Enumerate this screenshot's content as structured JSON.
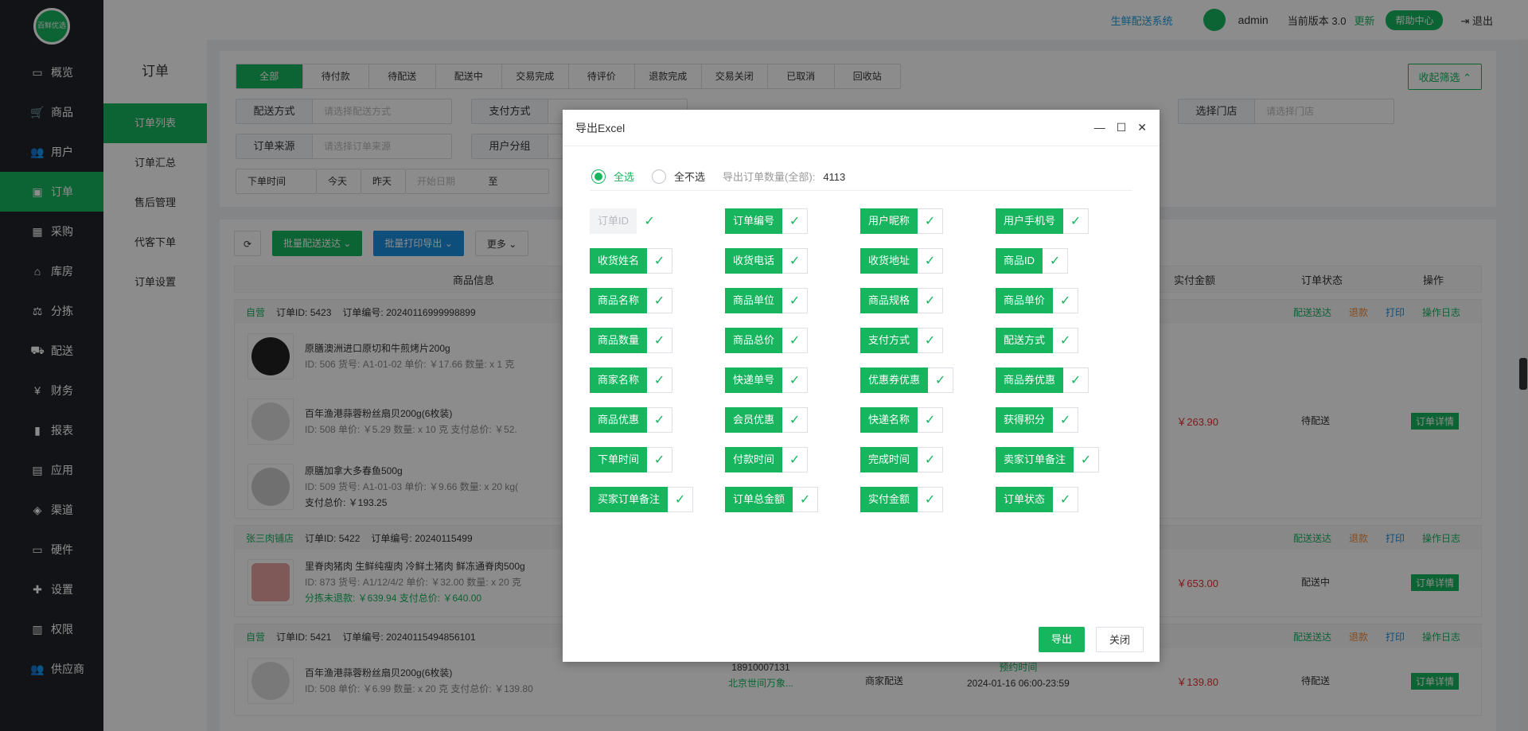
{
  "brand": {
    "logo_text": "百鲜优选"
  },
  "sidebar": {
    "items": [
      {
        "icon": "monitor-icon",
        "glyph": "▭",
        "label": "概览"
      },
      {
        "icon": "cart-icon",
        "glyph": "🛒",
        "label": "商品"
      },
      {
        "icon": "users-icon",
        "glyph": "👥",
        "label": "用户"
      },
      {
        "icon": "money-icon",
        "glyph": "▣",
        "label": "订单"
      },
      {
        "icon": "bus-icon",
        "glyph": "▦",
        "label": "采购"
      },
      {
        "icon": "home-icon",
        "glyph": "⌂",
        "label": "库房"
      },
      {
        "icon": "scale-icon",
        "glyph": "⚖",
        "label": "分拣"
      },
      {
        "icon": "truck-icon",
        "glyph": "⛟",
        "label": "配送"
      },
      {
        "icon": "yen-icon",
        "glyph": "¥",
        "label": "财务"
      },
      {
        "icon": "chart-icon",
        "glyph": "▮",
        "label": "报表"
      },
      {
        "icon": "grid-icon",
        "glyph": "▤",
        "label": "应用"
      },
      {
        "icon": "cube-icon",
        "glyph": "◈",
        "label": "渠道"
      },
      {
        "icon": "hardware-icon",
        "glyph": "▭",
        "label": "硬件"
      },
      {
        "icon": "puzzle-icon",
        "glyph": "✚",
        "label": "设置"
      },
      {
        "icon": "bank-icon",
        "glyph": "▥",
        "label": "权限"
      },
      {
        "icon": "supplier-icon",
        "glyph": "👥",
        "label": "供应商"
      }
    ]
  },
  "subnav": {
    "title": "订单",
    "items": [
      "订单列表",
      "订单汇总",
      "售后管理",
      "代客下单",
      "订单设置"
    ]
  },
  "topbar": {
    "system": "生鲜配送系统",
    "user": "admin",
    "version_label": "当前版本",
    "version": "3.0",
    "update": "更新",
    "help": "帮助中心",
    "logout": "退出"
  },
  "filter": {
    "tabs": [
      "全部",
      "待付款",
      "待配送",
      "配送中",
      "交易完成",
      "待评价",
      "退款完成",
      "交易关闭",
      "已取消",
      "回收站"
    ],
    "collapse": "收起筛选",
    "row1": [
      {
        "label": "配送方式",
        "placeholder": "请选择配送方式"
      },
      {
        "label": "支付方式",
        "placeholder": ""
      }
    ],
    "store": {
      "label": "选择门店",
      "placeholder": "请选择门店"
    },
    "row2": [
      {
        "label": "订单来源",
        "placeholder": "请选择订单来源"
      },
      {
        "label": "用户分组",
        "placeholder": ""
      }
    ],
    "date": {
      "type": "下单时间",
      "today": "今天",
      "yesterday": "昨天",
      "start": "开始日期",
      "to": "至"
    }
  },
  "list": {
    "buttons": {
      "batch_delivery": "批量配送送达",
      "batch_print": "批量打印导出",
      "more": "更多"
    },
    "columns": {
      "product": "商品信息",
      "amount": "实付金额",
      "status": "订单状态",
      "ops": "操作"
    },
    "group_actions": {
      "deliver": "配送送达",
      "refund": "退款",
      "print": "打印",
      "log": "操作日志",
      "detail": "订单详情"
    },
    "orders": [
      {
        "shop": "自营",
        "id_label": "订单ID:",
        "id": "5423",
        "no_label": "订单编号:",
        "no": "20240116999998899",
        "amount": "￥263.90",
        "status": "待配送",
        "products": [
          {
            "name": "原膳澳洲进口原切和牛煎烤片200g",
            "meta": "ID: 506   货号: A1-01-02   单价: ￥17.66   数量: x 1 克"
          },
          {
            "name": "百年渔港蒜蓉粉丝扇贝200g(6枚装)",
            "meta": "ID: 508   单价: ￥5.29   数量: x 10 克   支付总价: ￥52."
          },
          {
            "name": "原膳加拿大多春鱼500g",
            "meta": "ID: 509   货号: A1-01-03   单价: ￥9.66   数量: x 20 kg(",
            "extra": "支付总价: ￥193.25"
          }
        ]
      },
      {
        "shop": "张三肉铺店",
        "id_label": "订单ID:",
        "id": "5422",
        "no_label": "订单编号:",
        "no": "20240115499",
        "amount": "￥653.00",
        "status": "配送中",
        "products": [
          {
            "name": "里脊肉猪肉 生鲜纯瘦肉 冷鲜土猪肉 鲜冻通脊肉500g",
            "meta": "ID: 873   货号: A1/12/4/2   单价: ￥32.00   数量: x 20 克",
            "extra": "分拣未退款: ￥639.94   支付总价: ￥640.00"
          }
        ]
      },
      {
        "shop": "自营",
        "id_label": "订单ID:",
        "id": "5421",
        "no_label": "订单编号:",
        "no": "20240115494856101",
        "amount": "￥139.80",
        "status": "待配送",
        "products": [
          {
            "name": "百年渔港蒜蓉粉丝扇贝200g(6枚装)",
            "meta": "ID: 508   单价: ￥6.99   数量: x 20 克   支付总价: ￥139.80"
          }
        ],
        "contact": "18910007131",
        "address": "北京世间万象...",
        "delivery": "商家配送",
        "reserve": "预约时间",
        "slot": "2024-01-16 06:00-23:59"
      }
    ]
  },
  "modal": {
    "title": "导出Excel",
    "select_all": "全选",
    "select_none": "全不选",
    "count_label": "导出订单数量(全部):",
    "count": "4113",
    "fields": [
      "订单ID",
      "订单编号",
      "用户昵称",
      "用户手机号",
      "收货姓名",
      "收货电话",
      "收货地址",
      "商品ID",
      "商品名称",
      "商品单位",
      "商品规格",
      "商品单价",
      "商品数量",
      "商品总价",
      "支付方式",
      "配送方式",
      "商家名称",
      "快递单号",
      "优惠券优惠",
      "商品券优惠",
      "商品优惠",
      "会员优惠",
      "快递名称",
      "获得积分",
      "下单时间",
      "付款时间",
      "完成时间",
      "卖家订单备注",
      "买家订单备注",
      "订单总金额",
      "实付金额",
      "订单状态"
    ],
    "disabled_field": "订单ID",
    "export": "导出",
    "close": "关闭"
  }
}
